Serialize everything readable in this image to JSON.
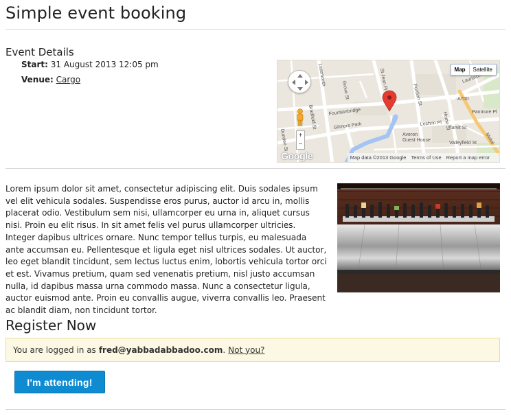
{
  "page": {
    "title": "Simple event booking"
  },
  "event_details": {
    "heading": "Event Details",
    "start_label": "Start:",
    "start_value": "31 August 2013 12:05 pm",
    "venue_label": "Venue:",
    "venue_value": "Cargo"
  },
  "map": {
    "type_options": [
      "Map",
      "Satellite"
    ],
    "selected_type": "Map",
    "zoom_in": "+",
    "zoom_out": "−",
    "logo": "Google",
    "attribution": {
      "data": "Map data ©2013 Google",
      "terms": "Terms of Use",
      "report": "Report a map error"
    },
    "street_labels": [
      "Pontion St",
      "Grove St",
      "Fountainbridge",
      "Gilmore Park",
      "Averon",
      "Guest House",
      "Lochrin Pl",
      "Tarvit St",
      "Home St",
      "Valleyfield St",
      "Panmure Pl",
      "Lauriston Pl",
      "A700",
      "Melvil",
      "St Jean Pl",
      "Dundee St",
      "Bradfield St",
      "Learmonth"
    ],
    "icons": {
      "pan": "pan-control-icon",
      "pegman": "street-view-pegman-icon",
      "marker": "location-marker-icon"
    }
  },
  "description": {
    "text": "Lorem ipsum dolor sit amet, consectetur adipiscing elit. Duis sodales ipsum vel elit vehicula sodales. Suspendisse eros purus, auctor id arcu in, mollis placerat odio. Vestibulum sem nisi, ullamcorper eu urna in, aliquet cursus nisi. Proin eu elit risus. In sit amet felis vel purus ullamcorper ultricies. Integer dapibus ultrices ornare. Nunc tempor tellus turpis, eu malesuada ante accumsan eu. Pellentesque et ligula eget nisl ultrices sodales. Ut auctor, leo eget blandit tincidunt, sem lectus luctus enim, lobortis vehicula tortor orci et est. Vivamus pretium, quam sed venenatis pretium, nisl justo accumsan nulla, id dapibus massa urna commodo massa. Nunc a consectetur ligula, auctor euismod ante. Proin eu convallis augue, viverra convallis leo. Praesent ac blandit diam, non tincidunt tortor."
  },
  "register": {
    "heading": "Register Now",
    "logged_in_prefix": "You are logged in as",
    "email": "fred@yabbadabbadoo.com",
    "email_suffix": ".",
    "not_you_link": "Not you?",
    "attend_button": "I'm attending!"
  },
  "colors": {
    "button_bg": "#0e8bd1",
    "alert_bg": "#fcf8e3",
    "alert_border": "#eedc94",
    "map_bg": "#ebe7df",
    "marker": "#e53b30"
  }
}
